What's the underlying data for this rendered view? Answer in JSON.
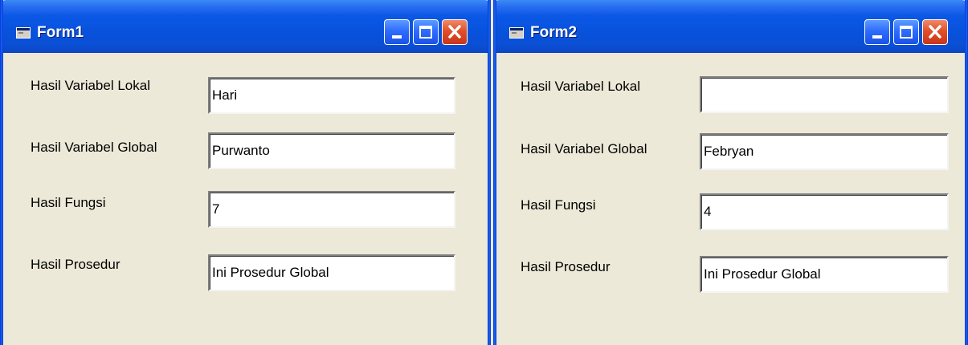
{
  "form1": {
    "title": "Form1",
    "labels": {
      "lokal": "Hasil Variabel Lokal",
      "global": "Hasil Variabel Global",
      "fungsi": "Hasil Fungsi",
      "prosedur": "Hasil Prosedur"
    },
    "values": {
      "lokal": "Hari",
      "global": "Purwanto",
      "fungsi": "7",
      "prosedur": "Ini Prosedur Global"
    }
  },
  "form2": {
    "title": "Form2",
    "labels": {
      "lokal": "Hasil Variabel Lokal",
      "global": "Hasil Variabel Global",
      "fungsi": "Hasil Fungsi",
      "prosedur": "Hasil Prosedur"
    },
    "values": {
      "lokal": "",
      "global": "Febryan",
      "fungsi": "4",
      "prosedur": "Ini Prosedur Global"
    }
  },
  "icons": {
    "app": "form-window-icon",
    "minimize": "minimize-icon",
    "maximize": "maximize-icon",
    "close": "close-icon"
  }
}
